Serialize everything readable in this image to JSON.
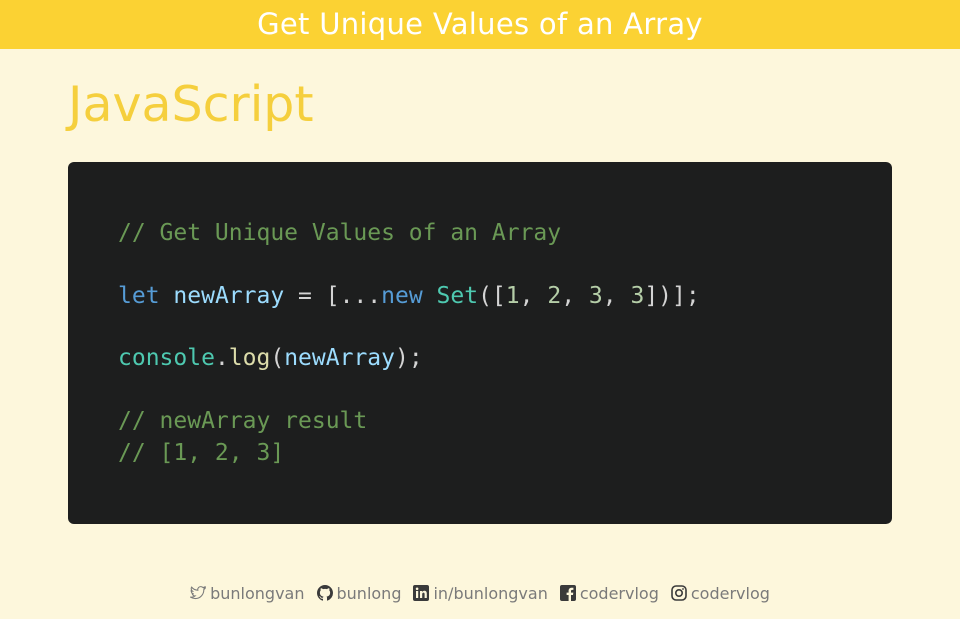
{
  "header": {
    "title": "Get Unique Values of an Array"
  },
  "language": "JavaScript",
  "code": {
    "comment1": "// Get Unique Values of an Array",
    "line2": {
      "kw_let": "let",
      "var": "newArray",
      "eq": " = [...",
      "kw_new": "new",
      "space": " ",
      "cls": "Set",
      "open": "([",
      "n1": "1",
      "c1": ", ",
      "n2": "2",
      "c2": ", ",
      "n3": "3",
      "c3": ", ",
      "n4": "3",
      "close": "])];"
    },
    "line3": {
      "obj": "console",
      "dot": ".",
      "fn": "log",
      "open": "(",
      "arg": "newArray",
      "close": ");"
    },
    "comment2": "// newArray result",
    "comment3": "// [1, 2, 3]"
  },
  "footer": {
    "twitter": "bunlongvan",
    "github": "bunlong",
    "linkedin": "in/bunlongvan",
    "facebook": "codervlog",
    "instagram": "codervlog"
  },
  "colors": {
    "header_bg": "#fbd233",
    "page_bg": "#fdf7dc",
    "title_yellow": "#f5cf3d",
    "code_bg": "#1d1e1e"
  },
  "icons": [
    "twitter-icon",
    "github-icon",
    "linkedin-icon",
    "facebook-icon",
    "instagram-icon"
  ]
}
